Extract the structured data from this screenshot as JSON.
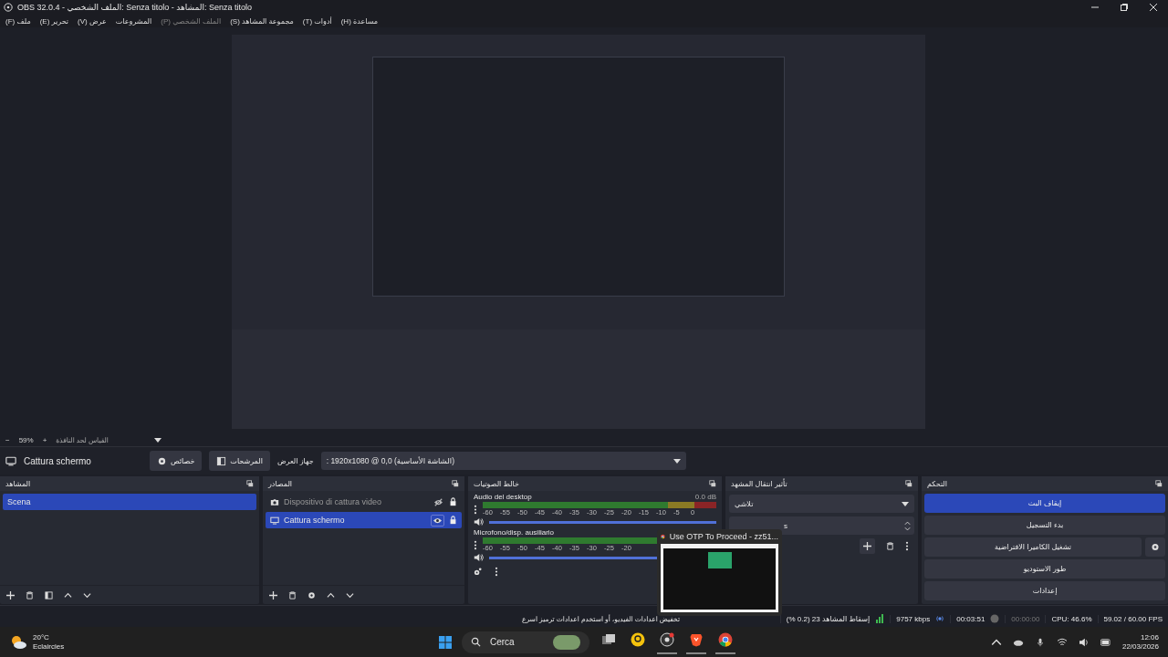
{
  "window": {
    "title": "OBS 32.0.4 - الملف الشخصي: Senza titolo - المشاهد: Senza titolo"
  },
  "menu": [
    {
      "label": "مساعدة (H)",
      "disabled": false
    },
    {
      "label": "أدوات (T)",
      "disabled": false
    },
    {
      "label": "مجموعة المشاهد (S)",
      "disabled": false
    },
    {
      "label": "الملف الشخصي (P)",
      "disabled": true
    },
    {
      "label": "المشروعات",
      "disabled": false
    },
    {
      "label": "عرض (V)",
      "disabled": false
    },
    {
      "label": "تحرير (E)",
      "disabled": false
    },
    {
      "label": "ملف (F)",
      "disabled": false
    }
  ],
  "zoom_bar": {
    "minus": "−",
    "zoom": "59%",
    "plus": "+",
    "fit": "القياس لحد النافذة"
  },
  "toolbar": {
    "source": "Cattura schermo",
    "properties": "خصائص",
    "filters": "المرشحات",
    "display_label": "جهاز العرض",
    "display_value": ": 1920x1080 @ 0,0 (الشاشة الأساسية)"
  },
  "scenes": {
    "title": "المشاهد",
    "items": [
      {
        "name": "Scena",
        "selected": true
      }
    ]
  },
  "sources": {
    "title": "المصادر",
    "items": [
      {
        "name": "Dispositivo di cattura video",
        "kind": "camera",
        "visible": false,
        "locked": true,
        "selected": false
      },
      {
        "name": "Cattura schermo",
        "kind": "monitor",
        "visible": true,
        "locked": true,
        "selected": true
      }
    ]
  },
  "mixer": {
    "title": "خالط الصوتيات",
    "channels": [
      {
        "name": "Audio del desktop",
        "reading": "0.0 dB",
        "level": 1,
        "ticks": [
          "0",
          "-5",
          "-10",
          "-15",
          "-20",
          "-25",
          "-30",
          "-35",
          "-40",
          "-45",
          "-50",
          "-55",
          "-60"
        ]
      },
      {
        "name": "Microfono/disp. ausiliario",
        "level": 1,
        "ticks": [
          "-20",
          "-25",
          "-30",
          "-35",
          "-40",
          "-45",
          "-50",
          "-55",
          "-60"
        ]
      }
    ]
  },
  "transitions": {
    "title": "تأثير انتقال المشهد",
    "type": "تلاشي",
    "duration": "s"
  },
  "controls": {
    "title": "التحكم",
    "buttons": [
      {
        "label": "إيقاف البث",
        "active": true,
        "gear": false
      },
      {
        "label": "بدء التسجيل",
        "active": false,
        "gear": false
      },
      {
        "label": "تشغيل الكاميرا الافتراضية",
        "active": false,
        "gear": true
      },
      {
        "label": "طور الاستوديو",
        "active": false,
        "gear": false
      },
      {
        "label": "إعدادات",
        "active": false,
        "gear": false
      }
    ]
  },
  "status_bar": {
    "message": "تخفيض اعدادات الفيديو، أو استخدم اعدادات ترميز اسرع",
    "dropped": "إسقاط المشاهد 23 (0.2 %)",
    "bitrate": "9757 kbps",
    "stream_time": "00:03:51",
    "record_time": "00:00:00",
    "cpu": "CPU: 46.6%",
    "fps": "59.02 / 60.00 FPS"
  },
  "popup": {
    "title": "Use OTP To Proceed - zz51..."
  },
  "taskbar": {
    "temperature": "20°C",
    "weather": "Eclaircies",
    "search": "Cerca",
    "apps": [
      {
        "kind": "files",
        "running": false
      },
      {
        "kind": "lens",
        "running": false
      },
      {
        "kind": "obs",
        "running": true
      },
      {
        "kind": "brave",
        "running": true
      },
      {
        "kind": "chrome",
        "running": true
      }
    ],
    "time": "12:06",
    "date": "22/03/2026"
  }
}
